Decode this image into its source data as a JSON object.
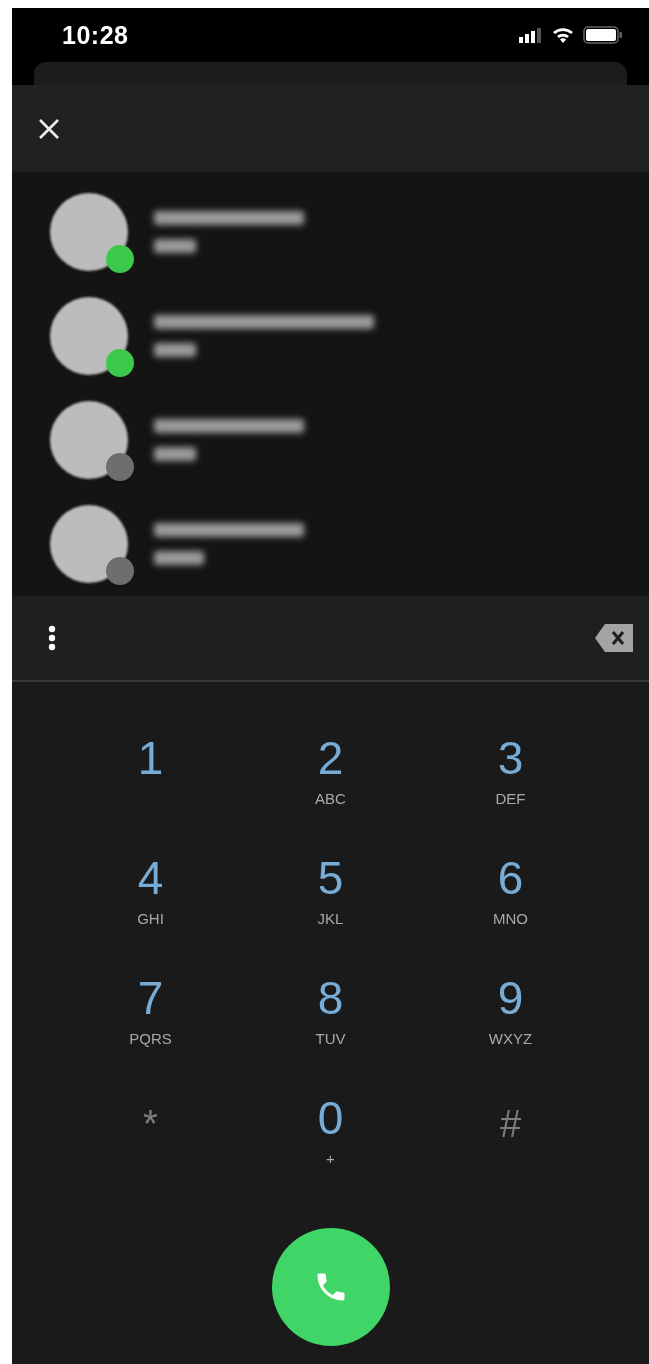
{
  "status_bar": {
    "time": "10:28"
  },
  "contacts": [
    {
      "color": "#3cc84a"
    },
    {
      "color": "#3cc84a"
    },
    {
      "color": "#6e6e6e"
    },
    {
      "color": "#6e6e6e"
    }
  ],
  "keypad": [
    {
      "digit": "1",
      "kind": "digit"
    },
    {
      "digit": "2",
      "letters": "ABC",
      "kind": "digit"
    },
    {
      "digit": "3",
      "letters": "DEF",
      "kind": "digit"
    },
    {
      "digit": "4",
      "letters": "GHI",
      "kind": "digit"
    },
    {
      "digit": "5",
      "letters": "JKL",
      "kind": "digit"
    },
    {
      "digit": "6",
      "letters": "MNO",
      "kind": "digit"
    },
    {
      "digit": "7",
      "letters": "PQRS",
      "kind": "digit"
    },
    {
      "digit": "8",
      "letters": "TUV",
      "kind": "digit"
    },
    {
      "digit": "9",
      "letters": "WXYZ",
      "kind": "digit"
    },
    {
      "digit": "*",
      "kind": "symbol"
    },
    {
      "digit": "0",
      "letters": "+",
      "kind": "digit"
    },
    {
      "digit": "#",
      "kind": "symbol"
    }
  ]
}
